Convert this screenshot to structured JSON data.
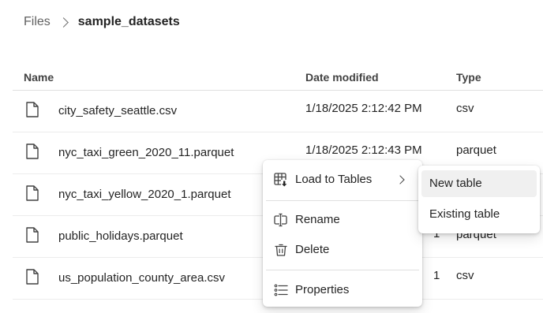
{
  "breadcrumb": {
    "root": "Files",
    "current": "sample_datasets"
  },
  "table": {
    "columns": [
      "Name",
      "Date modified",
      "Type"
    ],
    "rows": [
      {
        "name": "city_safety_seattle.csv",
        "date": "1/18/2025 2:12:42 PM",
        "type": "csv",
        "icon": "file-icon"
      },
      {
        "name": "nyc_taxi_green_2020_11.parquet",
        "date": "1/18/2025 2:12:43 PM",
        "type": "parquet",
        "icon": "file-icon"
      },
      {
        "name": "nyc_taxi_yellow_2020_1.parquet",
        "date": "",
        "type": "",
        "icon": "file-icon"
      },
      {
        "name": "public_holidays.parquet",
        "date": "1",
        "type": "parquet",
        "icon": "file-icon"
      },
      {
        "name": "us_population_county_area.csv",
        "date": "1",
        "type": "csv",
        "icon": "file-icon"
      }
    ]
  },
  "context_menu": {
    "items": [
      {
        "label": "Load to Tables",
        "icon": "table-load-icon",
        "has_submenu": true
      },
      {
        "label": "Rename",
        "icon": "rename-icon"
      },
      {
        "label": "Delete",
        "icon": "trash-icon"
      },
      {
        "label": "Properties",
        "icon": "properties-list-icon"
      }
    ]
  },
  "submenu": {
    "items": [
      {
        "label": "New table",
        "highlighted": true
      },
      {
        "label": "Existing table",
        "highlighted": false
      }
    ]
  },
  "colors": {
    "text": "#242424",
    "muted": "#616161",
    "divider": "#e0e0e0",
    "hover": "#f0f0f0"
  }
}
